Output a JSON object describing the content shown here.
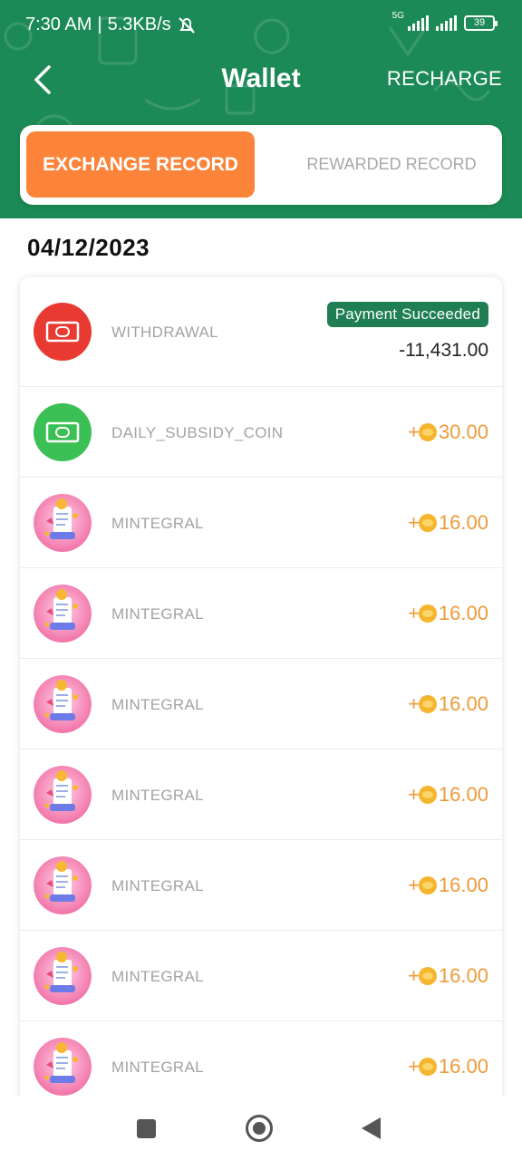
{
  "status_bar": {
    "time": "7:30 AM",
    "speed": "5.3KB/s",
    "network": "5G",
    "battery": "39"
  },
  "header": {
    "title": "Wallet",
    "recharge_label": "RECHARGE"
  },
  "tabs": {
    "active": "EXCHANGE RECORD",
    "inactive": "REWARDED RECORD"
  },
  "date": "04/12/2023",
  "records": [
    {
      "name": "WITHDRAWAL",
      "badge": "Payment Succeeded",
      "amount": "-11,431.00",
      "icon": "cash-icon",
      "color": "#e93a32"
    },
    {
      "name": "DAILY_SUBSIDY_COIN",
      "sign": "+",
      "amount": "30.00",
      "icon": "cash-icon",
      "color": "#3ac054"
    },
    {
      "name": "MINTEGRAL",
      "sign": "+",
      "amount": "16.00",
      "icon": "reward-illustration-icon"
    },
    {
      "name": "MINTEGRAL",
      "sign": "+",
      "amount": "16.00",
      "icon": "reward-illustration-icon"
    },
    {
      "name": "MINTEGRAL",
      "sign": "+",
      "amount": "16.00",
      "icon": "reward-illustration-icon"
    },
    {
      "name": "MINTEGRAL",
      "sign": "+",
      "amount": "16.00",
      "icon": "reward-illustration-icon"
    },
    {
      "name": "MINTEGRAL",
      "sign": "+",
      "amount": "16.00",
      "icon": "reward-illustration-icon"
    },
    {
      "name": "MINTEGRAL",
      "sign": "+",
      "amount": "16.00",
      "icon": "reward-illustration-icon"
    },
    {
      "name": "MINTEGRAL",
      "sign": "+",
      "amount": "16.00",
      "icon": "reward-illustration-icon"
    }
  ],
  "colors": {
    "header_green": "#1c8a56",
    "active_tab": "#fb843a",
    "coin_orange": "#ee9a3a",
    "badge_green": "#1f7f52"
  }
}
